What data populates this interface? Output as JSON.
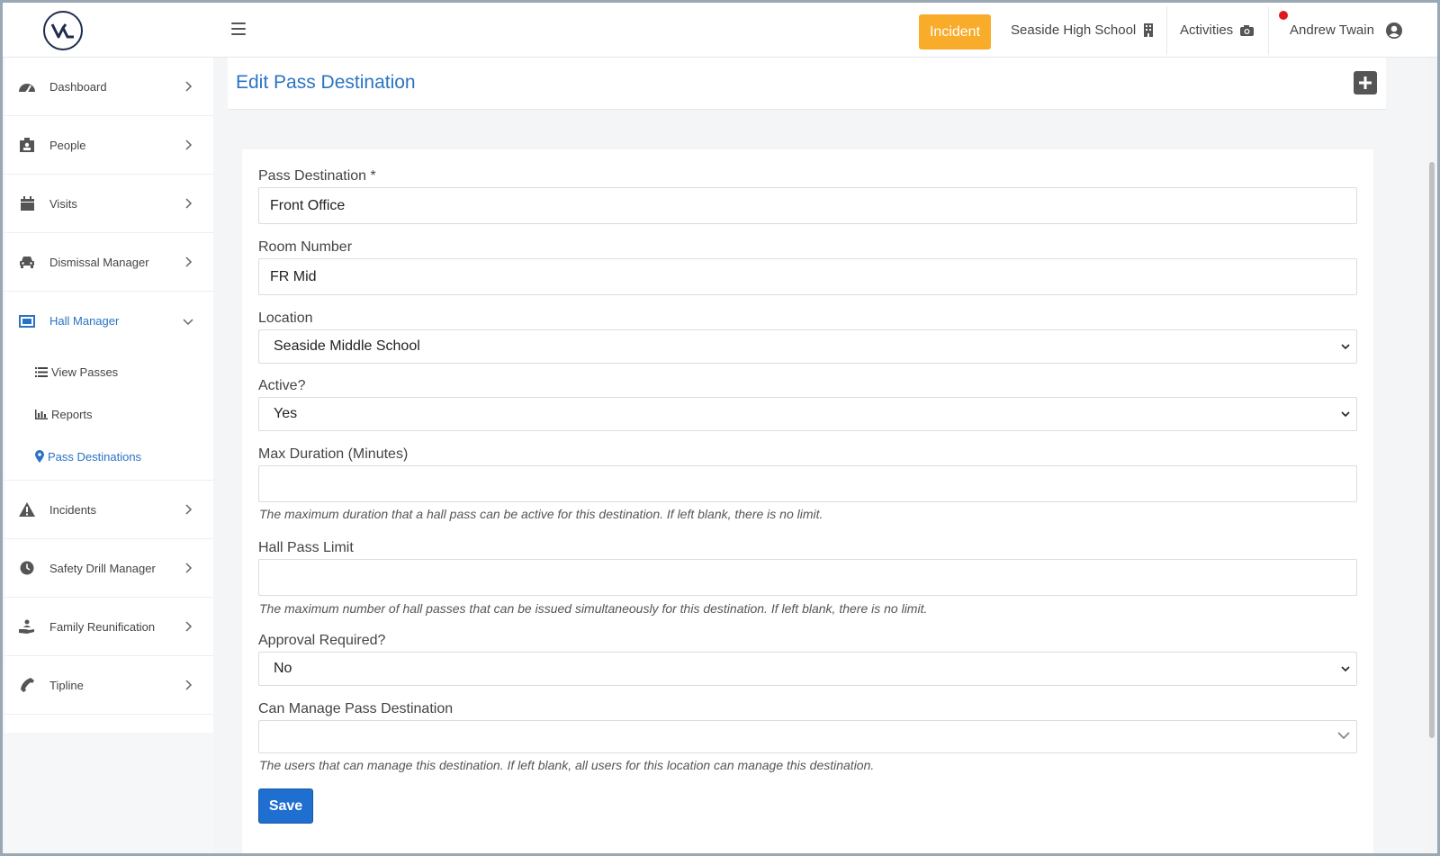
{
  "topbar": {
    "logo_text": "VA",
    "incident_label": "Incident",
    "school_label": "Seaside High School",
    "activities_label": "Activities",
    "user_label": "Andrew Twain",
    "notification_color": "#e0191b",
    "incident_color": "#f9ab2a"
  },
  "sidebar": {
    "items": [
      {
        "label": "Dashboard",
        "icon": "dashboard-icon"
      },
      {
        "label": "People",
        "icon": "id-badge-icon"
      },
      {
        "label": "Visits",
        "icon": "calendar-icon"
      },
      {
        "label": "Dismissal Manager",
        "icon": "car-icon"
      },
      {
        "label": "Hall Manager",
        "icon": "hall-pass-icon"
      },
      {
        "label": "Incidents",
        "icon": "warning-icon"
      },
      {
        "label": "Safety Drill Manager",
        "icon": "clock-icon"
      },
      {
        "label": "Family Reunification",
        "icon": "hand-person-icon"
      },
      {
        "label": "Tipline",
        "icon": "phone-icon"
      }
    ],
    "hall_manager_sub": [
      {
        "label": "View Passes",
        "icon": "list-icon"
      },
      {
        "label": "Reports",
        "icon": "bar-chart-icon"
      },
      {
        "label": "Pass Destinations",
        "icon": "map-marker-icon"
      }
    ]
  },
  "page": {
    "title": "Edit Pass Destination"
  },
  "form": {
    "pass_destination": {
      "label": "Pass Destination *",
      "value": "Front Office"
    },
    "room_number": {
      "label": "Room Number",
      "value": "FR Mid"
    },
    "location": {
      "label": "Location",
      "value": "Seaside Middle School"
    },
    "active": {
      "label": "Active?",
      "value": "Yes"
    },
    "max_duration": {
      "label": "Max Duration (Minutes)",
      "value": "",
      "help": "The maximum duration that a hall pass can be active for this destination. If left blank, there is no limit."
    },
    "hall_pass_limit": {
      "label": "Hall Pass Limit",
      "value": "",
      "help": "The maximum number of hall passes that can be issued simultaneously for this destination. If left blank, there is no limit."
    },
    "approval_required": {
      "label": "Approval Required?",
      "value": "No"
    },
    "can_manage": {
      "label": "Can Manage Pass Destination",
      "value": "",
      "help": "The users that can manage this destination. If left blank, all users for this location can manage this destination."
    },
    "save_label": "Save"
  }
}
